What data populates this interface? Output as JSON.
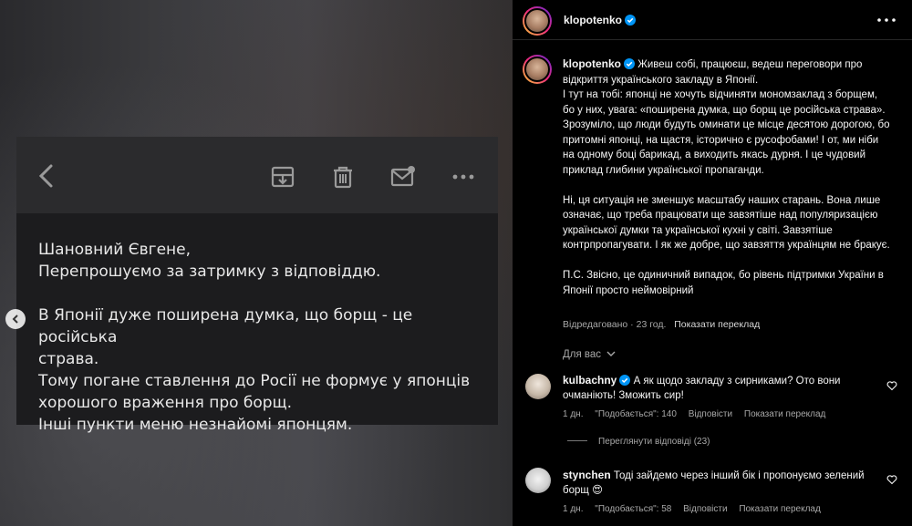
{
  "post_image": {
    "message_lines": [
      "Шановний Євгене,",
      "Перепрошуємо за затримку з відповіддю.",
      "",
      "В Японії дуже поширена думка, що борщ - це російська",
      "страва.",
      "Тому погане ставлення до Росії не формує у японців",
      "хорошого враження про борщ.",
      "Інші пункти меню незнайомі японцям."
    ]
  },
  "header": {
    "username": "klopotenko"
  },
  "caption": {
    "username": "klopotenko",
    "paragraphs": [
      "Живеш собі, працюєш, ведеш переговори про відкриття українського закладу в Японії.",
      "І тут на тобі: японці не хочуть відчиняти мономзаклад з борщем, бо у них, увага: «поширена думка, що борщ це російська страва». Зрозуміло, що люди будуть оминати це місце десятою дорогою, бо притомні японці, на щастя, історично є русофобами! І от, ми ніби на одному боці барикад, а виходить якась дурня. І це чудовий приклад глибини української пропаганди.",
      "Ні, ця ситуація не зменшує масштабу наших старань. Вона лише означає, що треба працювати ще завзятіше над популяризацією української думки та української кухні у світі. Завзятіше контрпропагувати. І як же добре, що завзяття українцям не бракує.",
      "П.С. Звісно, це одиничний випадок, бо рівень підтримки України в Японії просто неймовірний"
    ],
    "edited": "Відредаговано",
    "time": "23 год.",
    "translate": "Показати переклад"
  },
  "for_you": "Для вас",
  "comments": [
    {
      "username": "kulbachny",
      "text": "А як щодо закладу з сирниками? Ото вони очманіють! Зможить сир!",
      "time": "1 дн.",
      "likes": "\"Подобається\": 140",
      "reply": "Відповісти",
      "translate": "Показати переклад",
      "view_replies": "Переглянути відповіді (23)"
    },
    {
      "username": "stynchen",
      "text": "Тоді зайдемо через інший бік і пропонуємо зелений борщ 😍",
      "time": "1 дн.",
      "likes": "\"Подобається\": 58",
      "reply": "Відповісти",
      "translate": "Показати переклад"
    }
  ],
  "colors": {
    "verified": "#0095f6",
    "background": "#000000",
    "secondary_text": "#a8a8a8"
  },
  "icons": [
    "chevron-left-icon",
    "archive-icon",
    "trash-icon",
    "mail-unread-icon",
    "more-horizontal-icon",
    "verified-badge-icon",
    "heart-icon",
    "chevron-down-icon"
  ]
}
